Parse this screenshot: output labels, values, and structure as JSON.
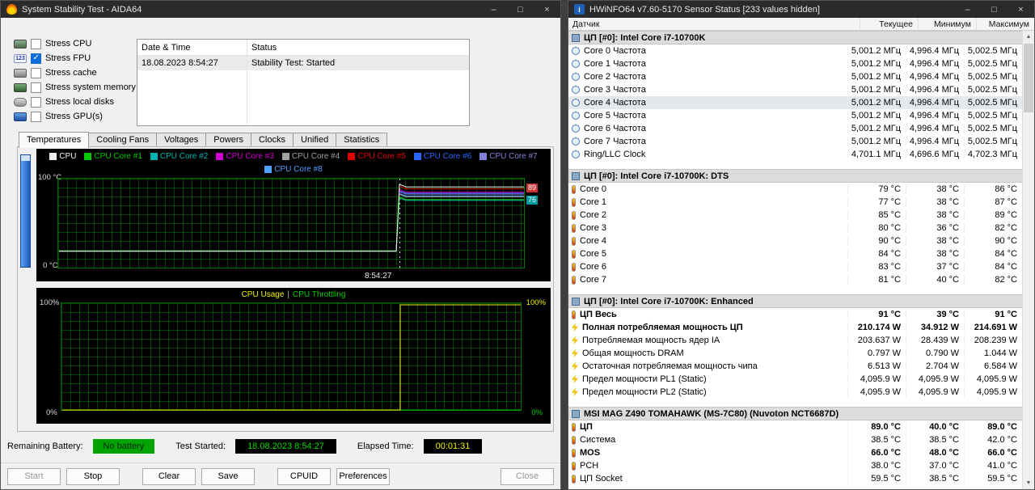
{
  "window_glyphs": [
    "–",
    "□",
    "×"
  ],
  "aida": {
    "title": "System Stability Test - AIDA64",
    "stress_options": [
      {
        "label": "Stress CPU",
        "checked": false,
        "icon": "cpu-icon",
        "glyph": ""
      },
      {
        "label": "Stress FPU",
        "checked": true,
        "icon": "fpu-icon",
        "glyph": "123"
      },
      {
        "label": "Stress cache",
        "checked": false,
        "icon": "cache-icon",
        "glyph": ""
      },
      {
        "label": "Stress system memory",
        "checked": false,
        "icon": "memory-icon",
        "glyph": ""
      },
      {
        "label": "Stress local disks",
        "checked": false,
        "icon": "disk-icon",
        "glyph": ""
      },
      {
        "label": "Stress GPU(s)",
        "checked": false,
        "icon": "gpu-icon",
        "glyph": ""
      }
    ],
    "events_table": {
      "columns": [
        "Date & Time",
        "Status"
      ],
      "rows": [
        [
          "18.08.2023 8:54:27",
          "Stability Test: Started"
        ]
      ]
    },
    "tabs": [
      "Temperatures",
      "Cooling Fans",
      "Voltages",
      "Powers",
      "Clocks",
      "Unified",
      "Statistics"
    ],
    "active_tab_index": 0,
    "temp_chart": {
      "y_top": "100 °C",
      "y_bottom": "0 °C",
      "time_label": "8:54:27",
      "baseline": 20,
      "spike_frac": 0.73,
      "series": [
        {
          "name": "CPU",
          "color": "#f0f0f0",
          "end": 91
        },
        {
          "name": "CPU Core #1",
          "color": "#00c800",
          "end": 77
        },
        {
          "name": "CPU Core #2",
          "color": "#00b4b4",
          "end": 76
        },
        {
          "name": "CPU Core #3",
          "color": "#d000d0",
          "end": 85
        },
        {
          "name": "CPU Core #4",
          "color": "#a0a0a0",
          "end": 80
        },
        {
          "name": "CPU Core #5",
          "color": "#e00000",
          "end": 89
        },
        {
          "name": "CPU Core #6",
          "color": "#2864ff",
          "end": 84
        },
        {
          "name": "CPU Core #7",
          "color": "#8080d8",
          "end": 83
        },
        {
          "name": "CPU Core #8",
          "color": "#50a0ff",
          "end": 81
        }
      ],
      "markers": [
        {
          "text": "89",
          "value": 89,
          "color": "#c83232"
        },
        {
          "text": "76",
          "value": 76,
          "color": "#009aa0"
        }
      ]
    },
    "usage_chart": {
      "title1": "CPU Usage",
      "sep": "|",
      "title2": "CPU Throttling",
      "title1_color": "#f0f000",
      "title2_color": "#00d000",
      "left_top": "100%",
      "left_bottom": "0%",
      "right_top": "100%",
      "right_bottom": "0%",
      "spike_frac": 0.735,
      "usage_color": "#f0f000",
      "throttle_color": "#00c000"
    },
    "status_bar": {
      "battery_label": "Remaining Battery:",
      "battery_value": "No battery",
      "test_started_label": "Test Started:",
      "test_started_value": "18.08.2023 8:54:27",
      "elapsed_label": "Elapsed Time:",
      "elapsed_value": "00:01:31"
    },
    "buttons": [
      {
        "label": "Start",
        "disabled": true,
        "gap": false,
        "right": false
      },
      {
        "label": "Stop",
        "disabled": false,
        "gap": false,
        "right": false
      },
      {
        "label": "Clear",
        "disabled": false,
        "gap": true,
        "right": false
      },
      {
        "label": "Save",
        "disabled": false,
        "gap": false,
        "right": false
      },
      {
        "label": "CPUID",
        "disabled": false,
        "gap": true,
        "right": false
      },
      {
        "label": "Preferences",
        "disabled": false,
        "gap": false,
        "right": false
      },
      {
        "label": "Close",
        "disabled": true,
        "gap": false,
        "right": true
      }
    ]
  },
  "hwinfo": {
    "title": "HWiNFO64 v7.60-5170 Sensor Status [233 values hidden]",
    "columns": [
      "Датчик",
      "Текущее",
      "Минимум",
      "Максимум"
    ],
    "sections": [
      {
        "name": "ЦП [#0]: Intel Core i7-10700K",
        "rows": [
          {
            "label": "Core 0 Частота",
            "icon": "clock",
            "cur": "5,001.2 МГц",
            "min": "4,996.4 МГц",
            "max": "5,002.5 МГц",
            "bold": false,
            "selected": false
          },
          {
            "label": "Core 1 Частота",
            "icon": "clock",
            "cur": "5,001.2 МГц",
            "min": "4,996.4 МГц",
            "max": "5,002.5 МГц",
            "bold": false,
            "selected": false
          },
          {
            "label": "Core 2 Частота",
            "icon": "clock",
            "cur": "5,001.2 МГц",
            "min": "4,996.4 МГц",
            "max": "5,002.5 МГц",
            "bold": false,
            "selected": false
          },
          {
            "label": "Core 3 Частота",
            "icon": "clock",
            "cur": "5,001.2 МГц",
            "min": "4,996.4 МГц",
            "max": "5,002.5 МГц",
            "bold": false,
            "selected": false
          },
          {
            "label": "Core 4 Частота",
            "icon": "clock",
            "cur": "5,001.2 МГц",
            "min": "4,996.4 МГц",
            "max": "5,002.5 МГц",
            "bold": false,
            "selected": true
          },
          {
            "label": "Core 5 Частота",
            "icon": "clock",
            "cur": "5,001.2 МГц",
            "min": "4,996.4 МГц",
            "max": "5,002.5 МГц",
            "bold": false,
            "selected": false
          },
          {
            "label": "Core 6 Частота",
            "icon": "clock",
            "cur": "5,001.2 МГц",
            "min": "4,996.4 МГц",
            "max": "5,002.5 МГц",
            "bold": false,
            "selected": false
          },
          {
            "label": "Core 7 Частота",
            "icon": "clock",
            "cur": "5,001.2 МГц",
            "min": "4,996.4 МГц",
            "max": "5,002.5 МГц",
            "bold": false,
            "selected": false
          },
          {
            "label": "Ring/LLC Clock",
            "icon": "clock",
            "cur": "4,701.1 МГц",
            "min": "4,696.6 МГц",
            "max": "4,702.3 МГц",
            "bold": false,
            "selected": false
          }
        ]
      },
      {
        "name": "ЦП [#0]: Intel Core i7-10700K: DTS",
        "rows": [
          {
            "label": "Core 0",
            "icon": "temp",
            "cur": "79 °C",
            "min": "38 °C",
            "max": "86 °C",
            "bold": false,
            "selected": false
          },
          {
            "label": "Core 1",
            "icon": "temp",
            "cur": "77 °C",
            "min": "38 °C",
            "max": "87 °C",
            "bold": false,
            "selected": false
          },
          {
            "label": "Core 2",
            "icon": "temp",
            "cur": "85 °C",
            "min": "38 °C",
            "max": "89 °C",
            "bold": false,
            "selected": false
          },
          {
            "label": "Core 3",
            "icon": "temp",
            "cur": "80 °C",
            "min": "36 °C",
            "max": "82 °C",
            "bold": false,
            "selected": false
          },
          {
            "label": "Core 4",
            "icon": "temp",
            "cur": "90 °C",
            "min": "38 °C",
            "max": "90 °C",
            "bold": false,
            "selected": false
          },
          {
            "label": "Core 5",
            "icon": "temp",
            "cur": "84 °C",
            "min": "38 °C",
            "max": "84 °C",
            "bold": false,
            "selected": false
          },
          {
            "label": "Core 6",
            "icon": "temp",
            "cur": "83 °C",
            "min": "37 °C",
            "max": "84 °C",
            "bold": false,
            "selected": false
          },
          {
            "label": "Core 7",
            "icon": "temp",
            "cur": "81 °C",
            "min": "40 °C",
            "max": "82 °C",
            "bold": false,
            "selected": false
          }
        ]
      },
      {
        "name": "ЦП [#0]: Intel Core i7-10700K: Enhanced",
        "rows": [
          {
            "label": "ЦП Весь",
            "icon": "temp",
            "cur": "91 °C",
            "min": "39 °C",
            "max": "91 °C",
            "bold": true,
            "selected": false
          },
          {
            "label": "Полная потребляемая мощность ЦП",
            "icon": "power",
            "cur": "210.174 W",
            "min": "34.912 W",
            "max": "214.691 W",
            "bold": true,
            "selected": false
          },
          {
            "label": "Потребляемая мощность ядер IA",
            "icon": "power",
            "cur": "203.637 W",
            "min": "28.439 W",
            "max": "208.239 W",
            "bold": false,
            "selected": false
          },
          {
            "label": "Общая мощность DRAM",
            "icon": "power",
            "cur": "0.797 W",
            "min": "0.790 W",
            "max": "1.044 W",
            "bold": false,
            "selected": false
          },
          {
            "label": "Остаточная потребляемая мощность чипа",
            "icon": "power",
            "cur": "6.513 W",
            "min": "2.704 W",
            "max": "6.584 W",
            "bold": false,
            "selected": false
          },
          {
            "label": "Предел мощности PL1 (Static)",
            "icon": "power",
            "cur": "4,095.9 W",
            "min": "4,095.9 W",
            "max": "4,095.9 W",
            "bold": false,
            "selected": false
          },
          {
            "label": "Предел мощности PL2 (Static)",
            "icon": "power",
            "cur": "4,095.9 W",
            "min": "4,095.9 W",
            "max": "4,095.9 W",
            "bold": false,
            "selected": false
          }
        ]
      },
      {
        "name": "MSI MAG Z490 TOMAHAWK (MS-7C80) (Nuvoton NCT6687D)",
        "rows": [
          {
            "label": "ЦП",
            "icon": "temp",
            "cur": "89.0 °C",
            "min": "40.0 °C",
            "max": "89.0 °C",
            "bold": true,
            "selected": false
          },
          {
            "label": "Система",
            "icon": "temp",
            "cur": "38.5 °C",
            "min": "38.5 °C",
            "max": "42.0 °C",
            "bold": false,
            "selected": false
          },
          {
            "label": "MOS",
            "icon": "temp",
            "cur": "66.0 °C",
            "min": "48.0 °C",
            "max": "66.0 °C",
            "bold": true,
            "selected": false
          },
          {
            "label": "PCH",
            "icon": "temp",
            "cur": "38.0 °C",
            "min": "37.0 °C",
            "max": "41.0 °C",
            "bold": false,
            "selected": false
          },
          {
            "label": "ЦП Socket",
            "icon": "temp",
            "cur": "59.5 °C",
            "min": "38.5 °C",
            "max": "59.5 °C",
            "bold": false,
            "selected": false
          }
        ]
      }
    ]
  }
}
